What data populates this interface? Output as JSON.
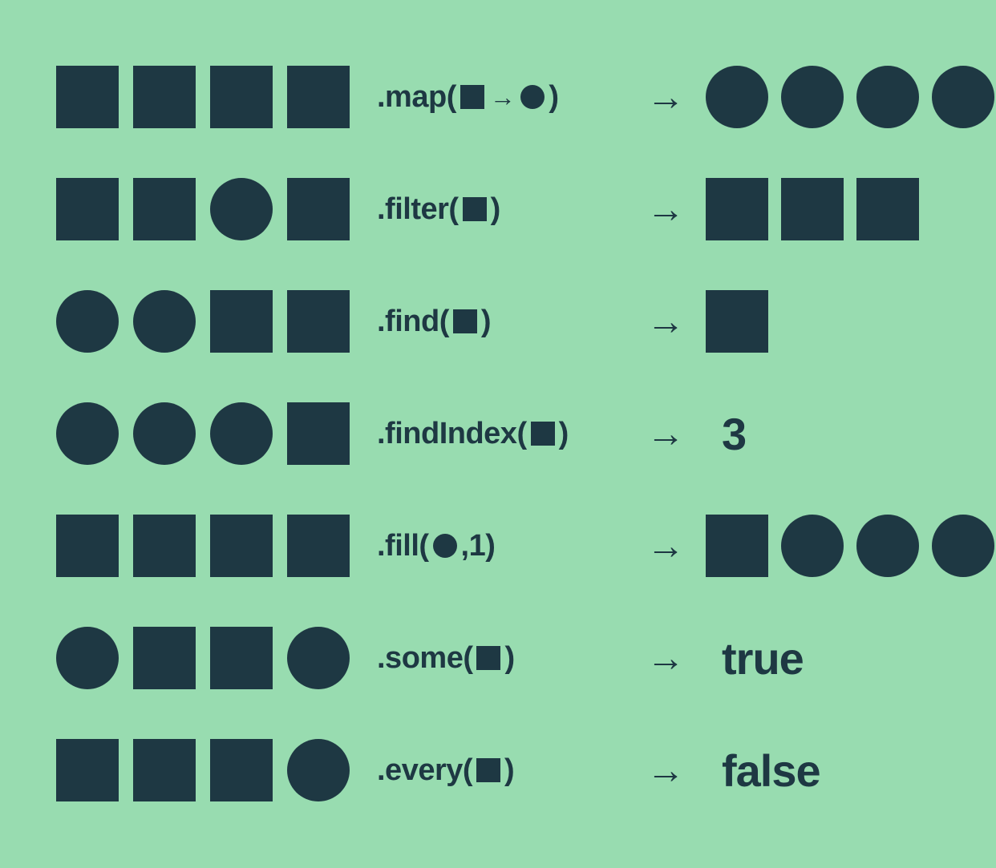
{
  "colors": {
    "background": "#98dcb0",
    "shape": "#1e3843"
  },
  "arrow_glyph": "→",
  "rows": [
    {
      "input": [
        "square",
        "square",
        "square",
        "square"
      ],
      "method": {
        "prefix": ".map(",
        "args": [
          {
            "type": "shape",
            "shape": "square"
          },
          {
            "type": "arrow"
          },
          {
            "type": "shape",
            "shape": "circle"
          }
        ],
        "suffix": ")"
      },
      "output": {
        "type": "shapes",
        "shapes": [
          "circle",
          "circle",
          "circle",
          "circle"
        ]
      }
    },
    {
      "input": [
        "square",
        "square",
        "circle",
        "square"
      ],
      "method": {
        "prefix": ".filter(",
        "args": [
          {
            "type": "shape",
            "shape": "square"
          }
        ],
        "suffix": ")"
      },
      "output": {
        "type": "shapes",
        "shapes": [
          "square",
          "square",
          "square"
        ]
      }
    },
    {
      "input": [
        "circle",
        "circle",
        "square",
        "square"
      ],
      "method": {
        "prefix": ".find(",
        "args": [
          {
            "type": "shape",
            "shape": "square"
          }
        ],
        "suffix": ")"
      },
      "output": {
        "type": "shapes",
        "shapes": [
          "square"
        ]
      }
    },
    {
      "input": [
        "circle",
        "circle",
        "circle",
        "square"
      ],
      "method": {
        "prefix": ".findIndex(",
        "args": [
          {
            "type": "shape",
            "shape": "square"
          }
        ],
        "suffix": ")"
      },
      "output": {
        "type": "text",
        "value": "3"
      }
    },
    {
      "input": [
        "square",
        "square",
        "square",
        "square"
      ],
      "method": {
        "prefix": ".fill(",
        "args": [
          {
            "type": "shape",
            "shape": "circle"
          },
          {
            "type": "text",
            "value": ",1"
          }
        ],
        "suffix": " )"
      },
      "output": {
        "type": "shapes",
        "shapes": [
          "square",
          "circle",
          "circle",
          "circle"
        ]
      }
    },
    {
      "input": [
        "circle",
        "square",
        "square",
        "circle"
      ],
      "method": {
        "prefix": ".some(",
        "args": [
          {
            "type": "shape",
            "shape": "square"
          }
        ],
        "suffix": ")"
      },
      "output": {
        "type": "text",
        "value": "true"
      }
    },
    {
      "input": [
        "square",
        "square",
        "square",
        "circle"
      ],
      "method": {
        "prefix": ".every(",
        "args": [
          {
            "type": "shape",
            "shape": "square"
          }
        ],
        "suffix": ")"
      },
      "output": {
        "type": "text",
        "value": "false"
      }
    }
  ]
}
